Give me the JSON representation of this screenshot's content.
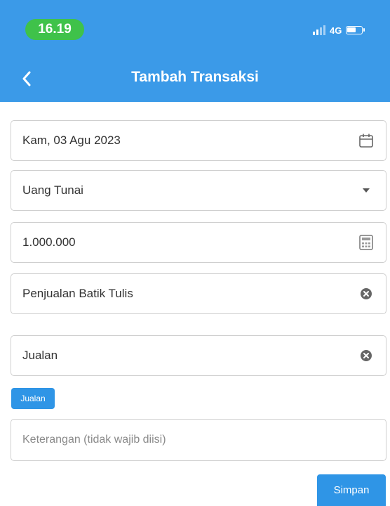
{
  "status_bar": {
    "time": "16.19",
    "network": "4G"
  },
  "header": {
    "title": "Tambah Transaksi"
  },
  "form": {
    "date": {
      "value": "Kam, 03 Agu 2023"
    },
    "payment_method": {
      "value": "Uang Tunai"
    },
    "amount": {
      "value": "1.000.000"
    },
    "description": {
      "value": "Penjualan Batik Tulis"
    },
    "category": {
      "value": "Jualan"
    },
    "category_chip": "Jualan",
    "note": {
      "placeholder": "Keterangan (tidak wajib diisi)"
    }
  },
  "actions": {
    "save_label": "Simpan"
  },
  "colors": {
    "primary": "#3b9ae8",
    "button": "#2f95e6",
    "time_pill": "#3fc24a"
  },
  "icons": {
    "back": "chevron-left-icon",
    "date": "calendar-icon",
    "payment_method": "caret-down-icon",
    "amount": "calculator-icon",
    "clear": "clear-circle-icon"
  }
}
